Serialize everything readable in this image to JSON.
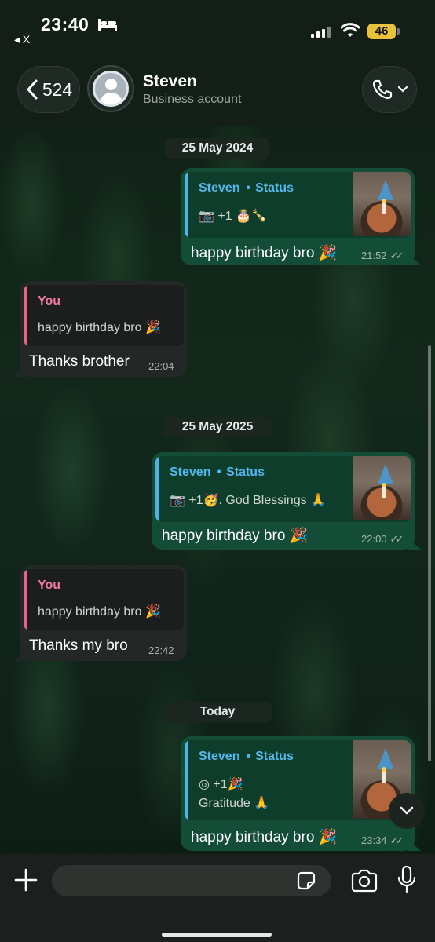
{
  "status_bar": {
    "time": "23:40",
    "back_to_app": "◂ X",
    "battery": "46"
  },
  "header": {
    "back_count": "524",
    "contact_name": "Steven",
    "contact_subtitle": "Business account"
  },
  "messages": [
    {
      "date": "25 May 2024",
      "outgoing": {
        "quote_author": "Steven",
        "quote_label": "Status",
        "quote_line1": "📷 +1 🎂🍾",
        "quote_line2": "",
        "text": "happy birthday bro 🎉",
        "time": "21:52"
      },
      "incoming": {
        "quote_author": "You",
        "quote_line1": "happy birthday bro 🎉",
        "text": "Thanks brother",
        "time": "22:04"
      }
    },
    {
      "date": "25 May 2025",
      "outgoing": {
        "quote_author": "Steven",
        "quote_label": "Status",
        "quote_line1": "📷 +1🥳. God Blessings 🙏",
        "quote_line2": "",
        "text": "happy birthday bro 🎉",
        "time": "22:00"
      },
      "incoming": {
        "quote_author": "You",
        "quote_line1": "happy birthday bro 🎉",
        "text": "Thanks my bro",
        "time": "22:42"
      }
    },
    {
      "date": "Today",
      "outgoing": {
        "quote_author": "Steven",
        "quote_label": "Status",
        "quote_line1": "◎ +1🎉",
        "quote_line2": "Gratitude 🙏",
        "text": "happy birthday bro 🎉",
        "time": "23:34"
      }
    }
  ],
  "input": {
    "placeholder": ""
  },
  "icons": {
    "plus": "plus-icon",
    "sticker": "sticker-icon",
    "camera": "camera-icon",
    "mic": "microphone-icon",
    "phone": "phone-icon",
    "scroll_down": "chevron-down-icon"
  },
  "colors": {
    "outgoing_bubble": "#144d37",
    "incoming_bubble": "#232826",
    "status_quote_accent": "#4fb3e8",
    "you_quote_accent": "#e8628c",
    "battery": "#e8c23a"
  }
}
